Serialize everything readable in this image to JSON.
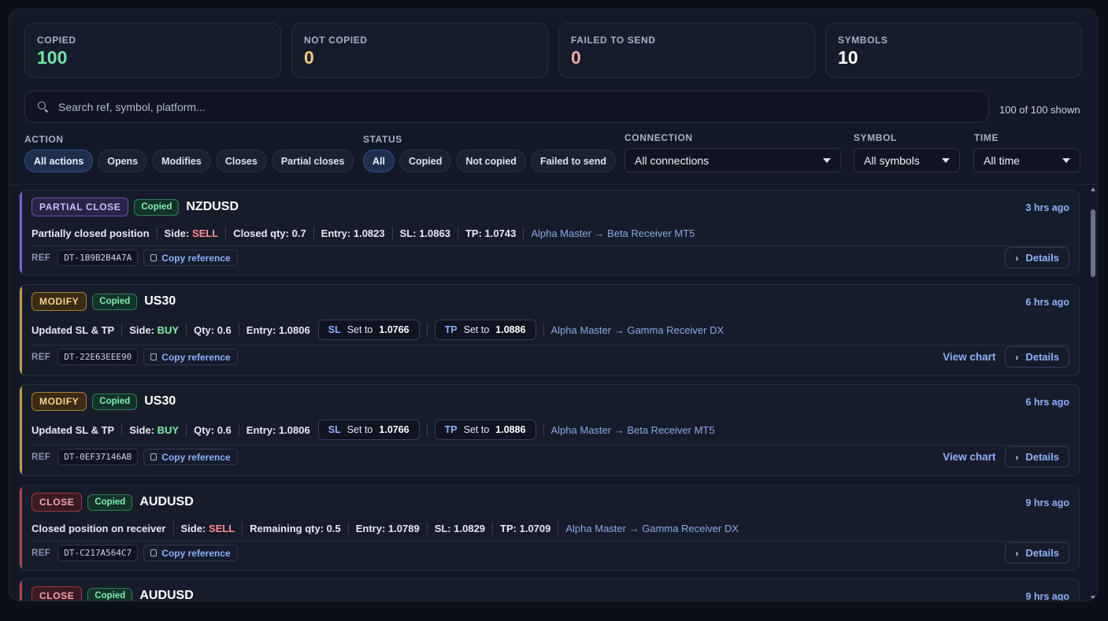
{
  "stats": [
    {
      "label": "COPIED",
      "value": "100"
    },
    {
      "label": "NOT COPIED",
      "value": "0"
    },
    {
      "label": "FAILED TO SEND",
      "value": "0"
    },
    {
      "label": "SYMBOLS",
      "value": "10"
    }
  ],
  "search": {
    "placeholder": "Search ref, symbol, platform...",
    "shown": "100 of 100 shown"
  },
  "filters": {
    "action": {
      "label": "ACTION",
      "options": [
        "All actions",
        "Opens",
        "Modifies",
        "Closes",
        "Partial closes"
      ],
      "selected": "All actions"
    },
    "status": {
      "label": "STATUS",
      "options": [
        "All",
        "Copied",
        "Not copied",
        "Failed to send"
      ],
      "selected": "All"
    },
    "connection": {
      "label": "CONNECTION",
      "value": "All connections"
    },
    "symbol": {
      "label": "SYMBOL",
      "value": "All symbols"
    },
    "time": {
      "label": "TIME",
      "value": "All time"
    }
  },
  "labels": {
    "ref": "REF",
    "copy_reference": "Copy reference",
    "details": "Details",
    "view_chart": "View chart",
    "copied": "Copied",
    "side": "Side:",
    "entry": "Entry:",
    "sl": "SL:",
    "tp": "TP:",
    "set_to": "Set to",
    "sl_key": "SL",
    "tp_key": "TP"
  },
  "events": [
    {
      "action": "PARTIAL CLOSE",
      "status": "Copied",
      "symbol": "NZDUSD",
      "time": "3 hrs ago",
      "description": "Partially closed position",
      "side": "SELL",
      "qty_label": "Closed qty: 0.7",
      "entry": "1.0823",
      "sl": "1.0863",
      "tp": "1.0743",
      "route": "Alpha Master → Beta Receiver MT5",
      "ref": "DT-1B9B2B4A7A"
    },
    {
      "action": "MODIFY",
      "status": "Copied",
      "symbol": "US30",
      "time": "6 hrs ago",
      "description": "Updated SL & TP",
      "side": "BUY",
      "qty_label": "Qty: 0.6",
      "entry": "1.0806",
      "sl_set": "1.0766",
      "tp_set": "1.0886",
      "route": "Alpha Master → Gamma Receiver DX",
      "ref": "DT-22E63EEE90"
    },
    {
      "action": "MODIFY",
      "status": "Copied",
      "symbol": "US30",
      "time": "6 hrs ago",
      "description": "Updated SL & TP",
      "side": "BUY",
      "qty_label": "Qty: 0.6",
      "entry": "1.0806",
      "sl_set": "1.0766",
      "tp_set": "1.0886",
      "route": "Alpha Master → Beta Receiver MT5",
      "ref": "DT-0EF37146AB"
    },
    {
      "action": "CLOSE",
      "status": "Copied",
      "symbol": "AUDUSD",
      "time": "9 hrs ago",
      "description": "Closed position on receiver",
      "side": "SELL",
      "qty_label": "Remaining qty: 0.5",
      "entry": "1.0789",
      "sl": "1.0829",
      "tp": "1.0709",
      "route": "Alpha Master → Gamma Receiver DX",
      "ref": "DT-C217A564C7"
    },
    {
      "action": "CLOSE",
      "status": "Copied",
      "symbol": "AUDUSD",
      "time": "9 hrs ago"
    }
  ],
  "colors": {
    "accent": "#8fb0ff",
    "copied": "#6ee7a8",
    "sell": "#ff8c96",
    "buy": "#7df0ad"
  }
}
